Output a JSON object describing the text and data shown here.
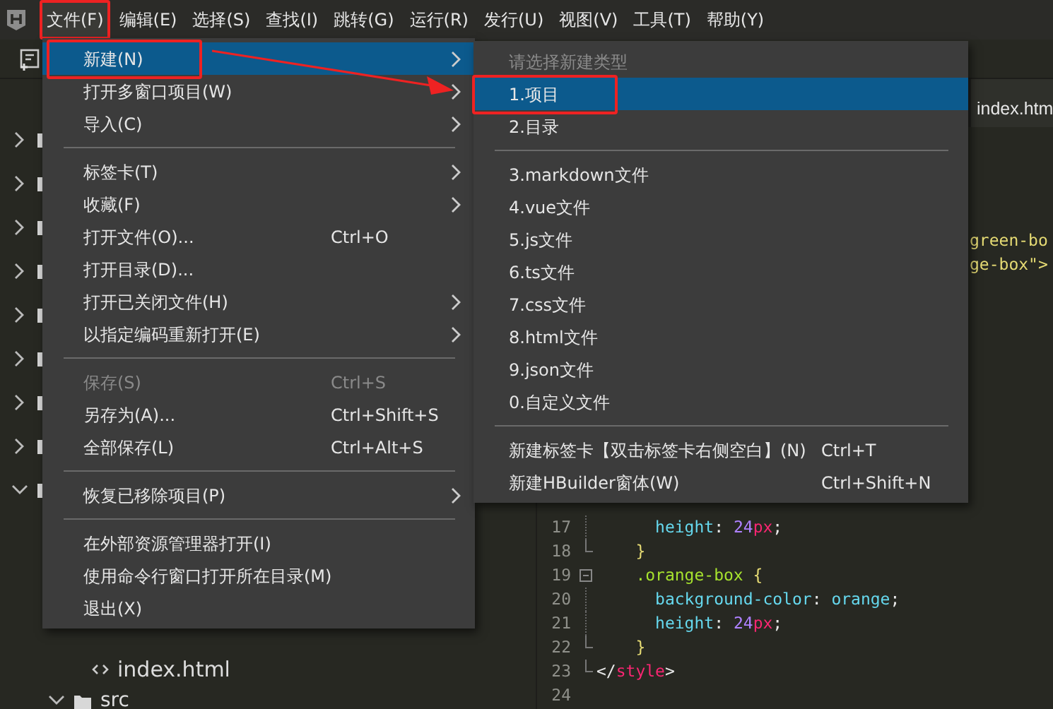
{
  "menubar": [
    {
      "label": "文件(F)",
      "selected": true,
      "highlighted": true
    },
    {
      "label": "编辑(E)",
      "selected": false,
      "highlighted": false
    },
    {
      "label": "选择(S)",
      "selected": false,
      "highlighted": false
    },
    {
      "label": "查找(I)",
      "selected": false,
      "highlighted": false
    },
    {
      "label": "跳转(G)",
      "selected": false,
      "highlighted": false
    },
    {
      "label": "运行(R)",
      "selected": false,
      "highlighted": false
    },
    {
      "label": "发行(U)",
      "selected": false,
      "highlighted": false
    },
    {
      "label": "视图(V)",
      "selected": false,
      "highlighted": false
    },
    {
      "label": "工具(T)",
      "selected": false,
      "highlighted": false
    },
    {
      "label": "帮助(Y)",
      "selected": false,
      "highlighted": false
    }
  ],
  "file_menu": [
    {
      "kind": "item",
      "label": "新建(N)",
      "submenu": true,
      "selected": true,
      "highlighted": true,
      "disabled": false
    },
    {
      "kind": "item",
      "label": "打开多窗口项目(W)",
      "submenu": true,
      "selected": false,
      "highlighted": false,
      "disabled": false
    },
    {
      "kind": "item",
      "label": "导入(C)",
      "submenu": true,
      "selected": false,
      "highlighted": false,
      "disabled": false
    },
    {
      "kind": "separator"
    },
    {
      "kind": "item",
      "label": "标签卡(T)",
      "submenu": true,
      "selected": false,
      "highlighted": false,
      "disabled": false
    },
    {
      "kind": "item",
      "label": "收藏(F)",
      "submenu": true,
      "selected": false,
      "highlighted": false,
      "disabled": false
    },
    {
      "kind": "item",
      "label": "打开文件(O)...",
      "shortcut": "Ctrl+O",
      "submenu": false,
      "selected": false,
      "highlighted": false,
      "disabled": false
    },
    {
      "kind": "item",
      "label": "打开目录(D)...",
      "submenu": false,
      "selected": false,
      "highlighted": false,
      "disabled": false
    },
    {
      "kind": "item",
      "label": "打开已关闭文件(H)",
      "submenu": true,
      "selected": false,
      "highlighted": false,
      "disabled": false
    },
    {
      "kind": "item",
      "label": "以指定编码重新打开(E)",
      "submenu": true,
      "selected": false,
      "highlighted": false,
      "disabled": false
    },
    {
      "kind": "separator"
    },
    {
      "kind": "item",
      "label": "保存(S)",
      "shortcut": "Ctrl+S",
      "submenu": false,
      "selected": false,
      "highlighted": false,
      "disabled": true
    },
    {
      "kind": "item",
      "label": "另存为(A)...",
      "shortcut": "Ctrl+Shift+S",
      "submenu": false,
      "selected": false,
      "highlighted": false,
      "disabled": false
    },
    {
      "kind": "item",
      "label": "全部保存(L)",
      "shortcut": "Ctrl+Alt+S",
      "submenu": false,
      "selected": false,
      "highlighted": false,
      "disabled": false
    },
    {
      "kind": "separator"
    },
    {
      "kind": "item",
      "label": "恢复已移除项目(P)",
      "submenu": true,
      "selected": false,
      "highlighted": false,
      "disabled": false
    },
    {
      "kind": "separator"
    },
    {
      "kind": "item",
      "label": "在外部资源管理器打开(I)",
      "submenu": false,
      "selected": false,
      "highlighted": false,
      "disabled": false
    },
    {
      "kind": "item",
      "label": "使用命令行窗口打开所在目录(M)",
      "submenu": false,
      "selected": false,
      "highlighted": false,
      "disabled": false
    },
    {
      "kind": "item",
      "label": "退出(X)",
      "submenu": false,
      "selected": false,
      "highlighted": false,
      "disabled": false
    }
  ],
  "new_submenu": [
    {
      "kind": "header",
      "label": "请选择新建类型"
    },
    {
      "kind": "item",
      "label": "1.项目",
      "selected": true,
      "highlighted": true
    },
    {
      "kind": "item",
      "label": "2.目录",
      "selected": false,
      "highlighted": false
    },
    {
      "kind": "separator"
    },
    {
      "kind": "item",
      "label": "3.markdown文件",
      "selected": false,
      "highlighted": false
    },
    {
      "kind": "item",
      "label": "4.vue文件",
      "selected": false,
      "highlighted": false
    },
    {
      "kind": "item",
      "label": "5.js文件",
      "selected": false,
      "highlighted": false
    },
    {
      "kind": "item",
      "label": "6.ts文件",
      "selected": false,
      "highlighted": false
    },
    {
      "kind": "item",
      "label": "7.css文件",
      "selected": false,
      "highlighted": false
    },
    {
      "kind": "item",
      "label": "8.html文件",
      "selected": false,
      "highlighted": false
    },
    {
      "kind": "item",
      "label": "9.json文件",
      "selected": false,
      "highlighted": false
    },
    {
      "kind": "item",
      "label": "0.自定义文件",
      "selected": false,
      "highlighted": false
    },
    {
      "kind": "separator"
    },
    {
      "kind": "item",
      "label": "新建标签卡【双击标签卡右侧空白】(N)",
      "shortcut": "Ctrl+T",
      "selected": false,
      "highlighted": false
    },
    {
      "kind": "item",
      "label": "新建HBuilder窗体(W)",
      "shortcut": "Ctrl+Shift+N",
      "selected": false,
      "highlighted": false
    }
  ],
  "sidebar": {
    "tree": [
      {
        "kind": "folder",
        "expanded": false
      },
      {
        "kind": "folder",
        "expanded": false
      },
      {
        "kind": "folder",
        "expanded": false
      },
      {
        "kind": "folder",
        "expanded": false
      },
      {
        "kind": "folder",
        "expanded": false
      },
      {
        "kind": "folder",
        "expanded": false
      },
      {
        "kind": "folder",
        "expanded": false
      },
      {
        "kind": "folder",
        "expanded": false
      },
      {
        "kind": "folder",
        "expanded": true,
        "children": [
          {
            "kind": "file",
            "label": "index.html"
          },
          {
            "kind": "folder",
            "label": "src",
            "expanded": true
          }
        ]
      }
    ]
  },
  "editor": {
    "tab": {
      "label": "index.htm",
      "selected": true
    },
    "fragments": [
      "green-bo",
      "ge-box\">"
    ],
    "lines": [
      {
        "number": "17",
        "tokens": [
          {
            "kind": "prop",
            "text": "      height"
          },
          {
            "kind": "punct",
            "text": ": "
          },
          {
            "kind": "num",
            "text": "24"
          },
          {
            "kind": "unit",
            "text": "px"
          },
          {
            "kind": "punct",
            "text": ";"
          }
        ]
      },
      {
        "number": "18",
        "tokens": [
          {
            "kind": "brace",
            "text": "    }"
          }
        ]
      },
      {
        "number": "19",
        "collapsible": true,
        "tokens": [
          {
            "kind": "selector",
            "text": "    .orange-box"
          },
          {
            "kind": "brace",
            "text": " {"
          }
        ]
      },
      {
        "number": "20",
        "tokens": [
          {
            "kind": "prop",
            "text": "      background-color"
          },
          {
            "kind": "punct",
            "text": ": "
          },
          {
            "kind": "value",
            "text": "orange"
          },
          {
            "kind": "punct",
            "text": ";"
          }
        ]
      },
      {
        "number": "21",
        "tokens": [
          {
            "kind": "prop",
            "text": "      height"
          },
          {
            "kind": "punct",
            "text": ": "
          },
          {
            "kind": "num",
            "text": "24"
          },
          {
            "kind": "unit",
            "text": "px"
          },
          {
            "kind": "punct",
            "text": ";"
          }
        ]
      },
      {
        "number": "22",
        "tokens": [
          {
            "kind": "brace",
            "text": "    }"
          }
        ]
      },
      {
        "number": "23",
        "tokens": [
          {
            "kind": "tagp",
            "text": "</"
          },
          {
            "kind": "tag",
            "text": "style"
          },
          {
            "kind": "tagp",
            "text": ">"
          }
        ]
      },
      {
        "number": "24"
      }
    ]
  }
}
